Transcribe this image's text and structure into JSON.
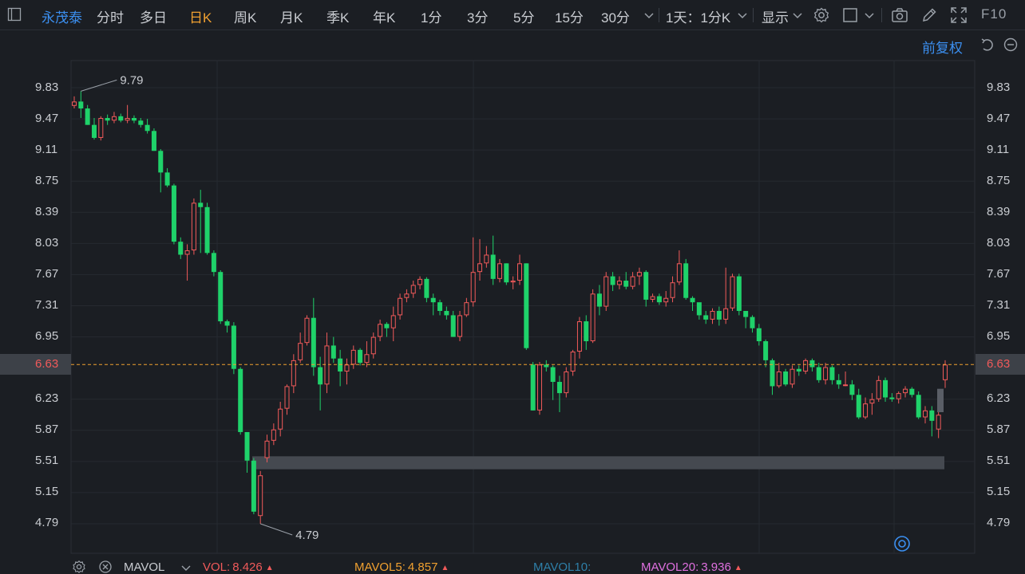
{
  "toolbar": {
    "stock_name": "永茂泰",
    "periods": [
      "分时",
      "多日",
      "日K",
      "周K",
      "月K",
      "季K",
      "年K",
      "1分",
      "3分",
      "5分",
      "15分",
      "30分"
    ],
    "active_period": "日K",
    "more_label": "1天：1分K",
    "display_label": "显示",
    "f10_label": "F10"
  },
  "adjust_label": "前复权",
  "current_price": "6.63",
  "chart_data": {
    "type": "candlestick",
    "y_ticks": [
      "9.83",
      "9.47",
      "9.11",
      "8.75",
      "8.39",
      "8.03",
      "7.67",
      "7.31",
      "6.95",
      "6.63",
      "6.23",
      "5.87",
      "5.51",
      "5.15",
      "4.79"
    ],
    "ylim": [
      4.79,
      9.83
    ],
    "max_label": "9.79",
    "min_label": "4.79",
    "current_price": 6.63,
    "colors": {
      "up": "#f15a5a",
      "down": "#1fd26a",
      "grid": "#262a30",
      "band": "#454950"
    },
    "band": {
      "low": 5.42,
      "high": 5.57
    },
    "candles": [
      [
        9.62,
        9.67,
        9.59,
        9.73
      ],
      [
        9.67,
        9.59,
        9.48,
        9.79
      ],
      [
        9.59,
        9.4,
        9.4,
        9.63
      ],
      [
        9.4,
        9.25,
        9.23,
        9.48
      ],
      [
        9.25,
        9.48,
        9.22,
        9.5
      ],
      [
        9.48,
        9.45,
        9.4,
        9.52
      ],
      [
        9.45,
        9.5,
        9.42,
        9.55
      ],
      [
        9.5,
        9.45,
        9.43,
        9.53
      ],
      [
        9.45,
        9.48,
        9.42,
        9.63
      ],
      [
        9.48,
        9.45,
        9.42,
        9.51
      ],
      [
        9.45,
        9.4,
        9.37,
        9.48
      ],
      [
        9.4,
        9.33,
        9.3,
        9.47
      ],
      [
        9.33,
        9.1,
        9.1,
        9.36
      ],
      [
        9.1,
        8.85,
        8.62,
        9.12
      ],
      [
        8.85,
        8.7,
        8.68,
        8.9
      ],
      [
        8.7,
        8.05,
        8.02,
        8.72
      ],
      [
        8.05,
        7.9,
        7.85,
        8.1
      ],
      [
        7.9,
        7.95,
        7.6,
        8.02
      ],
      [
        7.95,
        8.5,
        7.9,
        8.55
      ],
      [
        8.5,
        8.45,
        7.92,
        8.65
      ],
      [
        8.45,
        7.92,
        7.9,
        8.5
      ],
      [
        7.92,
        7.7,
        7.65,
        7.95
      ],
      [
        7.7,
        7.13,
        7.1,
        7.72
      ],
      [
        7.13,
        7.08,
        7.0,
        7.15
      ],
      [
        7.08,
        6.58,
        6.52,
        7.12
      ],
      [
        6.58,
        5.85,
        5.82,
        6.6
      ],
      [
        5.85,
        5.52,
        5.38,
        5.75
      ],
      [
        5.52,
        4.93,
        4.9,
        5.55
      ],
      [
        4.88,
        5.35,
        4.79,
        5.4
      ],
      [
        5.55,
        5.75,
        5.5,
        5.82
      ],
      [
        5.75,
        5.88,
        5.7,
        5.95
      ],
      [
        5.88,
        6.12,
        5.8,
        6.2
      ],
      [
        6.12,
        6.38,
        6.05,
        6.4
      ],
      [
        6.38,
        6.68,
        6.3,
        6.75
      ],
      [
        6.68,
        6.88,
        6.65,
        7.0
      ],
      [
        6.88,
        7.17,
        6.85,
        7.2
      ],
      [
        7.17,
        6.6,
        6.5,
        7.4
      ],
      [
        6.6,
        6.4,
        6.1,
        6.72
      ],
      [
        6.4,
        6.85,
        6.3,
        7.0
      ],
      [
        6.85,
        6.7,
        6.65,
        6.95
      ],
      [
        6.7,
        6.55,
        6.38,
        6.8
      ],
      [
        6.55,
        6.63,
        6.4,
        6.7
      ],
      [
        6.63,
        6.8,
        6.58,
        6.85
      ],
      [
        6.8,
        6.65,
        6.62,
        6.82
      ],
      [
        6.65,
        6.75,
        6.6,
        6.9
      ],
      [
        6.75,
        6.95,
        6.7,
        7.0
      ],
      [
        6.95,
        7.1,
        6.9,
        7.15
      ],
      [
        7.1,
        7.05,
        6.95,
        7.12
      ],
      [
        7.05,
        7.2,
        6.9,
        7.3
      ],
      [
        7.2,
        7.4,
        7.15,
        7.45
      ],
      [
        7.4,
        7.45,
        7.35,
        7.5
      ],
      [
        7.45,
        7.55,
        7.4,
        7.6
      ],
      [
        7.55,
        7.62,
        7.5,
        7.65
      ],
      [
        7.62,
        7.4,
        7.35,
        7.64
      ],
      [
        7.4,
        7.35,
        7.2,
        7.45
      ],
      [
        7.35,
        7.25,
        7.2,
        7.38
      ],
      [
        7.25,
        7.2,
        7.15,
        7.3
      ],
      [
        7.2,
        6.95,
        6.95,
        7.25
      ],
      [
        6.95,
        7.2,
        6.9,
        7.25
      ],
      [
        7.2,
        7.35,
        7.18,
        7.4
      ],
      [
        7.35,
        7.7,
        7.3,
        8.1
      ],
      [
        7.7,
        7.8,
        7.6,
        8.08
      ],
      [
        7.8,
        7.9,
        7.75,
        8.0
      ],
      [
        7.9,
        7.62,
        7.55,
        8.12
      ],
      [
        7.62,
        7.8,
        7.58,
        7.85
      ],
      [
        7.8,
        7.58,
        7.55,
        7.8
      ],
      [
        7.58,
        7.6,
        7.5,
        7.65
      ],
      [
        7.6,
        7.8,
        7.55,
        7.9
      ],
      [
        7.8,
        6.82,
        6.8,
        7.8
      ],
      [
        6.63,
        6.1,
        6.1,
        6.66
      ],
      [
        6.1,
        6.63,
        6.05,
        6.66
      ],
      [
        6.63,
        6.6,
        6.55,
        6.68
      ],
      [
        6.6,
        6.43,
        6.22,
        6.62
      ],
      [
        6.43,
        6.3,
        6.08,
        6.5
      ],
      [
        6.3,
        6.55,
        6.25,
        6.6
      ],
      [
        6.55,
        6.78,
        6.5,
        6.8
      ],
      [
        6.78,
        7.13,
        6.7,
        7.18
      ],
      [
        7.13,
        6.9,
        6.8,
        7.2
      ],
      [
        6.9,
        7.45,
        6.88,
        7.5
      ],
      [
        7.45,
        7.3,
        7.2,
        7.55
      ],
      [
        7.3,
        7.65,
        7.25,
        7.7
      ],
      [
        7.65,
        7.55,
        7.48,
        7.7
      ],
      [
        7.55,
        7.6,
        7.5,
        7.65
      ],
      [
        7.6,
        7.53,
        7.5,
        7.7
      ],
      [
        7.53,
        7.65,
        7.5,
        7.7
      ],
      [
        7.65,
        7.7,
        7.55,
        7.75
      ],
      [
        7.7,
        7.38,
        7.3,
        7.72
      ],
      [
        7.38,
        7.42,
        7.35,
        7.45
      ],
      [
        7.42,
        7.35,
        7.32,
        7.45
      ],
      [
        7.35,
        7.4,
        7.3,
        7.48
      ],
      [
        7.4,
        7.58,
        7.35,
        7.65
      ],
      [
        7.58,
        7.8,
        7.55,
        7.95
      ],
      [
        7.8,
        7.4,
        7.38,
        7.85
      ],
      [
        7.4,
        7.35,
        7.25,
        7.42
      ],
      [
        7.35,
        7.2,
        7.15,
        7.3
      ],
      [
        7.2,
        7.15,
        7.1,
        7.25
      ],
      [
        7.15,
        7.25,
        7.1,
        7.28
      ],
      [
        7.25,
        7.15,
        7.08,
        7.3
      ],
      [
        7.15,
        7.28,
        7.1,
        7.75
      ],
      [
        7.28,
        7.65,
        7.25,
        7.68
      ],
      [
        7.65,
        7.25,
        7.2,
        7.68
      ],
      [
        7.25,
        7.18,
        7.05,
        7.25
      ],
      [
        7.18,
        7.05,
        7.0,
        7.2
      ],
      [
        7.05,
        6.9,
        6.85,
        7.1
      ],
      [
        6.9,
        6.68,
        6.6,
        6.92
      ],
      [
        6.68,
        6.38,
        6.28,
        6.7
      ],
      [
        6.38,
        6.55,
        6.36,
        6.65
      ],
      [
        6.55,
        6.4,
        6.38,
        6.58
      ],
      [
        6.4,
        6.58,
        6.36,
        6.62
      ],
      [
        6.58,
        6.55,
        6.5,
        6.62
      ],
      [
        6.55,
        6.68,
        6.52,
        6.7
      ],
      [
        6.68,
        6.6,
        6.55,
        6.7
      ],
      [
        6.6,
        6.45,
        6.42,
        6.65
      ],
      [
        6.45,
        6.6,
        6.4,
        6.65
      ],
      [
        6.6,
        6.45,
        6.4,
        6.62
      ],
      [
        6.45,
        6.4,
        6.35,
        6.52
      ],
      [
        6.4,
        6.4,
        6.38,
        6.55
      ],
      [
        6.4,
        6.28,
        6.22,
        6.45
      ],
      [
        6.28,
        6.02,
        6.0,
        6.35
      ],
      [
        6.02,
        6.18,
        6.0,
        6.25
      ],
      [
        6.18,
        6.23,
        6.05,
        6.3
      ],
      [
        6.23,
        6.45,
        6.2,
        6.5
      ],
      [
        6.45,
        6.25,
        6.2,
        6.48
      ],
      [
        6.25,
        6.23,
        6.2,
        6.3
      ],
      [
        6.23,
        6.3,
        6.18,
        6.32
      ],
      [
        6.3,
        6.35,
        6.25,
        6.38
      ],
      [
        6.35,
        6.28,
        6.25,
        6.37
      ],
      [
        6.28,
        6.02,
        6.0,
        6.32
      ],
      [
        6.02,
        6.1,
        5.95,
        6.15
      ],
      [
        6.1,
        5.98,
        5.8,
        6.15
      ],
      [
        5.88,
        6.05,
        5.78,
        6.15
      ],
      [
        6.45,
        6.63,
        6.36,
        6.68
      ]
    ]
  },
  "vol_bar": {
    "label": "MAVOL",
    "vol": {
      "name": "VOL:",
      "value": "8.426",
      "color": "#f15a5a"
    },
    "mavol5": {
      "name": "MAVOL5:",
      "value": "4.857",
      "color": "#f0a030"
    },
    "mavol10": {
      "name": "MAVOL10:",
      "value": "",
      "color": "#2e7fa8"
    },
    "mavol20": {
      "name": "MAVOL20:",
      "value": "3.936",
      "color": "#e070e0"
    }
  }
}
